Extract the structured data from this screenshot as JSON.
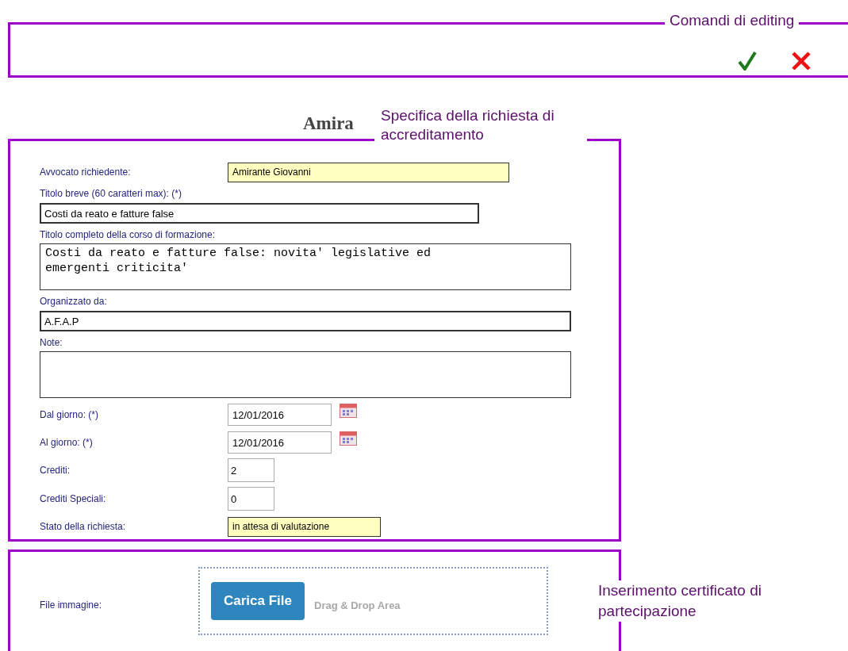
{
  "editing_commands": {
    "callout": "Comandi di editing",
    "actions": [
      {
        "kind": "confirm"
      },
      {
        "kind": "cancel"
      }
    ]
  },
  "page_heading": "Amira",
  "form": {
    "callout": "Specifica della richiesta di accreditamento",
    "fields": [
      {
        "kind": "inline",
        "label": "Avvocato richiedente:",
        "value": "Amirante Giovanni",
        "readonly": true
      },
      {
        "kind": "stacked",
        "label": "Titolo breve (60 caratteri max): (*)",
        "value": "Costi da reato e fatture false",
        "readonly": false
      },
      {
        "kind": "textarea",
        "label": "Titolo completo della corso di formazione:",
        "value": "Costi da reato e fatture false: novita' legislative ed emergenti criticita'",
        "readonly": false
      },
      {
        "kind": "stacked",
        "label": "Organizzato da:",
        "value": "A.F.A.P",
        "readonly": false
      },
      {
        "kind": "textarea",
        "label": "Note:",
        "readonly": false
      },
      {
        "kind": "date",
        "label": "Dal giorno: (*)",
        "value": "12/01/2016",
        "readonly": false
      },
      {
        "kind": "date",
        "label": "Al giorno: (*)",
        "value": "12/01/2016",
        "readonly": false
      },
      {
        "kind": "number",
        "label": "Crediti:",
        "value": "2",
        "readonly": false
      },
      {
        "kind": "number",
        "label": "Crediti Speciali:",
        "value": "0",
        "readonly": false
      },
      {
        "kind": "inline",
        "label": "Stato della richiesta:",
        "value": "in attesa di valutazione",
        "readonly": true
      }
    ]
  },
  "upload": {
    "callout": "Inserimento certificato di partecipazione",
    "label": "File immagine:",
    "button": "Carica File",
    "drop_hint": "Drag & Drop Area"
  }
}
